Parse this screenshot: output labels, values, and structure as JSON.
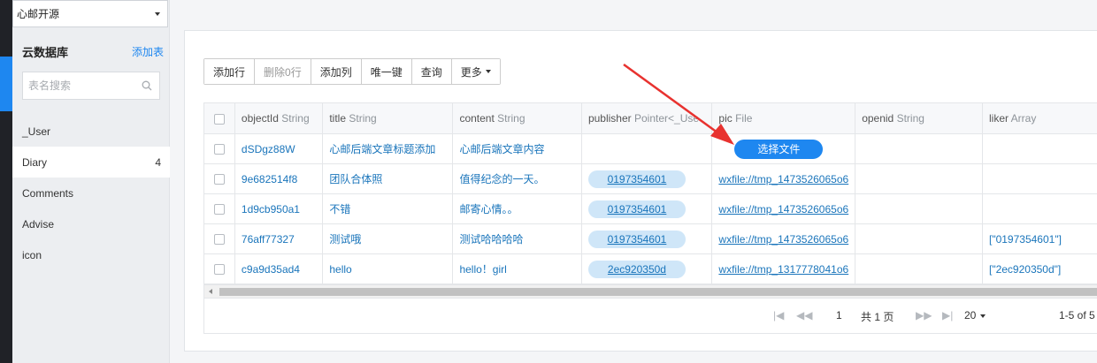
{
  "app_selector": {
    "value": "心邮开源"
  },
  "sidebar": {
    "title": "云数据库",
    "add_table": "添加表",
    "search_placeholder": "表名搜索",
    "items": [
      {
        "label": "_User",
        "count": ""
      },
      {
        "label": "Diary",
        "count": "4"
      },
      {
        "label": "Comments",
        "count": ""
      },
      {
        "label": "Advise",
        "count": ""
      },
      {
        "label": "icon",
        "count": ""
      }
    ]
  },
  "toolbar": {
    "add_row": "添加行",
    "delete_rows": "删除0行",
    "add_column": "添加列",
    "unique_key": "唯一键",
    "query": "查询",
    "more": "更多"
  },
  "table": {
    "columns": [
      {
        "name": "objectId",
        "type": "String"
      },
      {
        "name": "title",
        "type": "String"
      },
      {
        "name": "content",
        "type": "String"
      },
      {
        "name": "publisher",
        "type": "Pointer<_Use"
      },
      {
        "name": "pic",
        "type": "File"
      },
      {
        "name": "openid",
        "type": "String"
      },
      {
        "name": "liker",
        "type": "Array"
      }
    ],
    "upload_label": "选择文件",
    "rows": [
      {
        "objectId": "dSDgz88W",
        "title": "心邮后端文章标题添加",
        "content": "心邮后端文章内容",
        "publisher": "",
        "pic": "",
        "openid": "",
        "liker": ""
      },
      {
        "objectId": "9e682514f8",
        "title": "团队合体照",
        "content": "值得纪念的一天。",
        "publisher": "0197354601",
        "pic": "wxfile://tmp_1473526065o6",
        "openid": "",
        "liker": ""
      },
      {
        "objectId": "1d9cb950a1",
        "title": "不错",
        "content": "邮寄心情。。",
        "publisher": "0197354601",
        "pic": "wxfile://tmp_1473526065o6",
        "openid": "",
        "liker": ""
      },
      {
        "objectId": "76aff77327",
        "title": "测试哦",
        "content": "测试哈哈哈哈",
        "publisher": "0197354601",
        "pic": "wxfile://tmp_1473526065o6",
        "openid": "",
        "liker": "[\"0197354601\"]"
      },
      {
        "objectId": "c9a9d35ad4",
        "title": "hello",
        "content": "hello！girl",
        "publisher": "2ec920350d",
        "pic": "wxfile://tmp_1317778041o6",
        "openid": "",
        "liker": "[\"2ec920350d\"]"
      }
    ]
  },
  "pager": {
    "page": "1",
    "total_pages": "共 1 页",
    "page_size": "20",
    "range": "1-5 of 5"
  },
  "colors": {
    "accent": "#1e87f0",
    "annotation_arrow": "#e8322f"
  }
}
